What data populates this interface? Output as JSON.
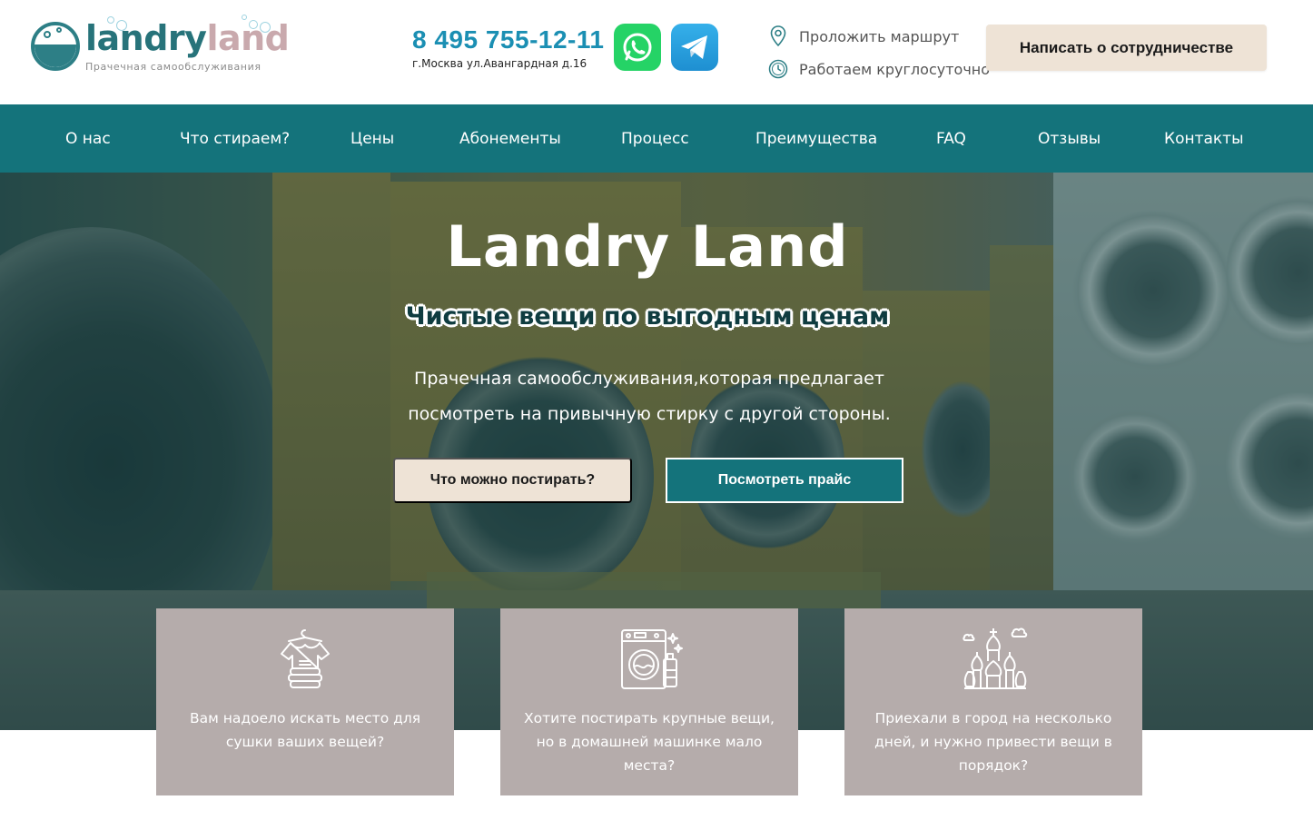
{
  "header": {
    "logo": {
      "part1": "landry",
      "part2": "land",
      "subtitle": "Прачечная самообслуживания"
    },
    "phone": "8 495 755-12-11",
    "address": "г.Москва ул.Авангардная д.16",
    "messengers": {
      "whatsapp_icon": "whatsapp-icon",
      "telegram_icon": "telegram-icon"
    },
    "route_label": "Проложить маршрут",
    "hours_label": "Работаем круглосуточно",
    "cta_label": "Написать о сотрудничестве"
  },
  "nav": {
    "items": [
      "О нас",
      "Что стираем?",
      "Цены",
      "Абонементы",
      "Процесс",
      "Преимущества",
      "FAQ",
      "Отзывы",
      "Контакты"
    ]
  },
  "hero": {
    "title": "Landry Land",
    "subtitle": "Чистые вещи по выгодным ценам",
    "description": "Прачечная самообслуживания,которая предлагает посмотреть на привычную стирку с другой стороны.",
    "btn_primary": "Что можно постирать?",
    "btn_secondary": "Посмотреть прайс"
  },
  "cards": [
    {
      "icon": "clothes-hanger-icon",
      "text": "Вам надоело искать место для сушки ваших вещей?"
    },
    {
      "icon": "washing-machine-icon",
      "text": "Хотите постирать крупные вещи, но в домашней машинке мало места?"
    },
    {
      "icon": "kremlin-icon",
      "text": "Приехали в город на несколько дней, и нужно привести вещи в порядок?"
    }
  ],
  "colors": {
    "brand_teal": "#14737b",
    "phone_blue": "#1b8fb3",
    "beige": "#eee3d6",
    "card_gray": "#b5acab",
    "logo_pink": "#c9a9ad"
  }
}
